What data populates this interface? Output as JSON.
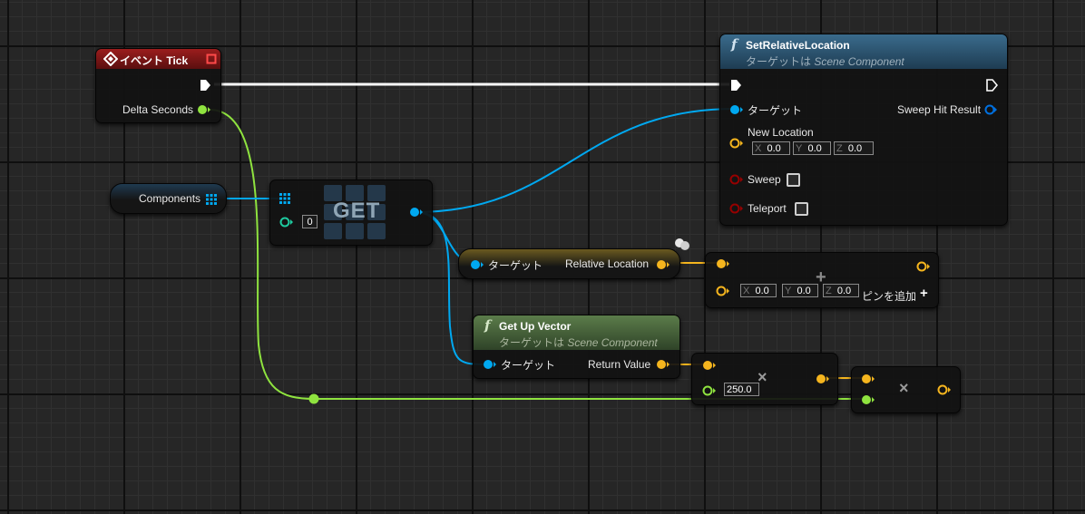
{
  "colors": {
    "exec": "#ffffff",
    "float": "#8fe33f",
    "object": "#00a8f0",
    "vector": "#f5b51e",
    "bool": "#960000",
    "int": "#1ecba0",
    "event_header": "#8e1b1b",
    "function_header": "#3a6b8c",
    "pure_header": "#5b7c4a"
  },
  "nodes": {
    "event_tick": {
      "title": "イベント Tick",
      "icon": "event-diamond-icon",
      "output_label": "Delta Seconds"
    },
    "set_relative_location": {
      "title": "SetRelativeLocation",
      "subtitle_prefix": "ターゲットは",
      "subtitle_class": "Scene Component",
      "target_label": "ターゲット",
      "return_label": "Sweep Hit Result",
      "new_location_label": "New Location",
      "x_label": "X",
      "x_value": "0.0",
      "y_label": "Y",
      "y_value": "0.0",
      "z_label": "Z",
      "z_value": "0.0",
      "sweep_label": "Sweep",
      "teleport_label": "Teleport"
    },
    "components": {
      "label": "Components"
    },
    "get": {
      "title": "GET",
      "index_value": "0"
    },
    "relative_location": {
      "target_label": "ターゲット",
      "output_label": "Relative Location"
    },
    "vector_add": {
      "x_label": "X",
      "x_value": "0.0",
      "y_label": "Y",
      "y_value": "0.0",
      "z_label": "Z",
      "z_value": "0.0",
      "add_pin_label": "ピンを追加",
      "add_pin_icon": "+"
    },
    "get_up_vector": {
      "title": "Get Up Vector",
      "subtitle_prefix": "ターゲットは",
      "subtitle_class": "Scene Component",
      "target_label": "ターゲット",
      "output_label": "Return Value"
    },
    "multiply_float": {
      "symbol": "×",
      "value": "250.0"
    },
    "multiply_vector": {
      "symbol": "×"
    }
  }
}
